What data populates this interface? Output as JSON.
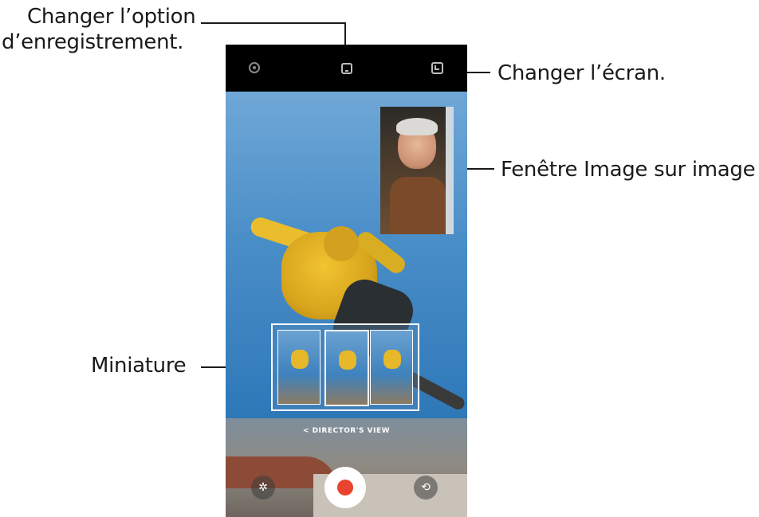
{
  "callouts": {
    "recording_option_line1": "Changer l’option",
    "recording_option_line2": "d’enregistrement.",
    "change_screen": "Changer l’écran.",
    "pip_window": "Fenêtre Image sur image",
    "thumbnail": "Miniature"
  },
  "camera": {
    "director_view_label": "< DIRECTOR'S VIEW",
    "record_color": "#e8442e",
    "icons": {
      "settings": "gear-icon",
      "recording_option": "recording-option-icon",
      "change_screen": "change-screen-icon",
      "effects": "effects-icon",
      "switch_camera": "switch-camera-icon"
    },
    "effect_glyph": "✲",
    "switch_glyph": "⟲"
  }
}
